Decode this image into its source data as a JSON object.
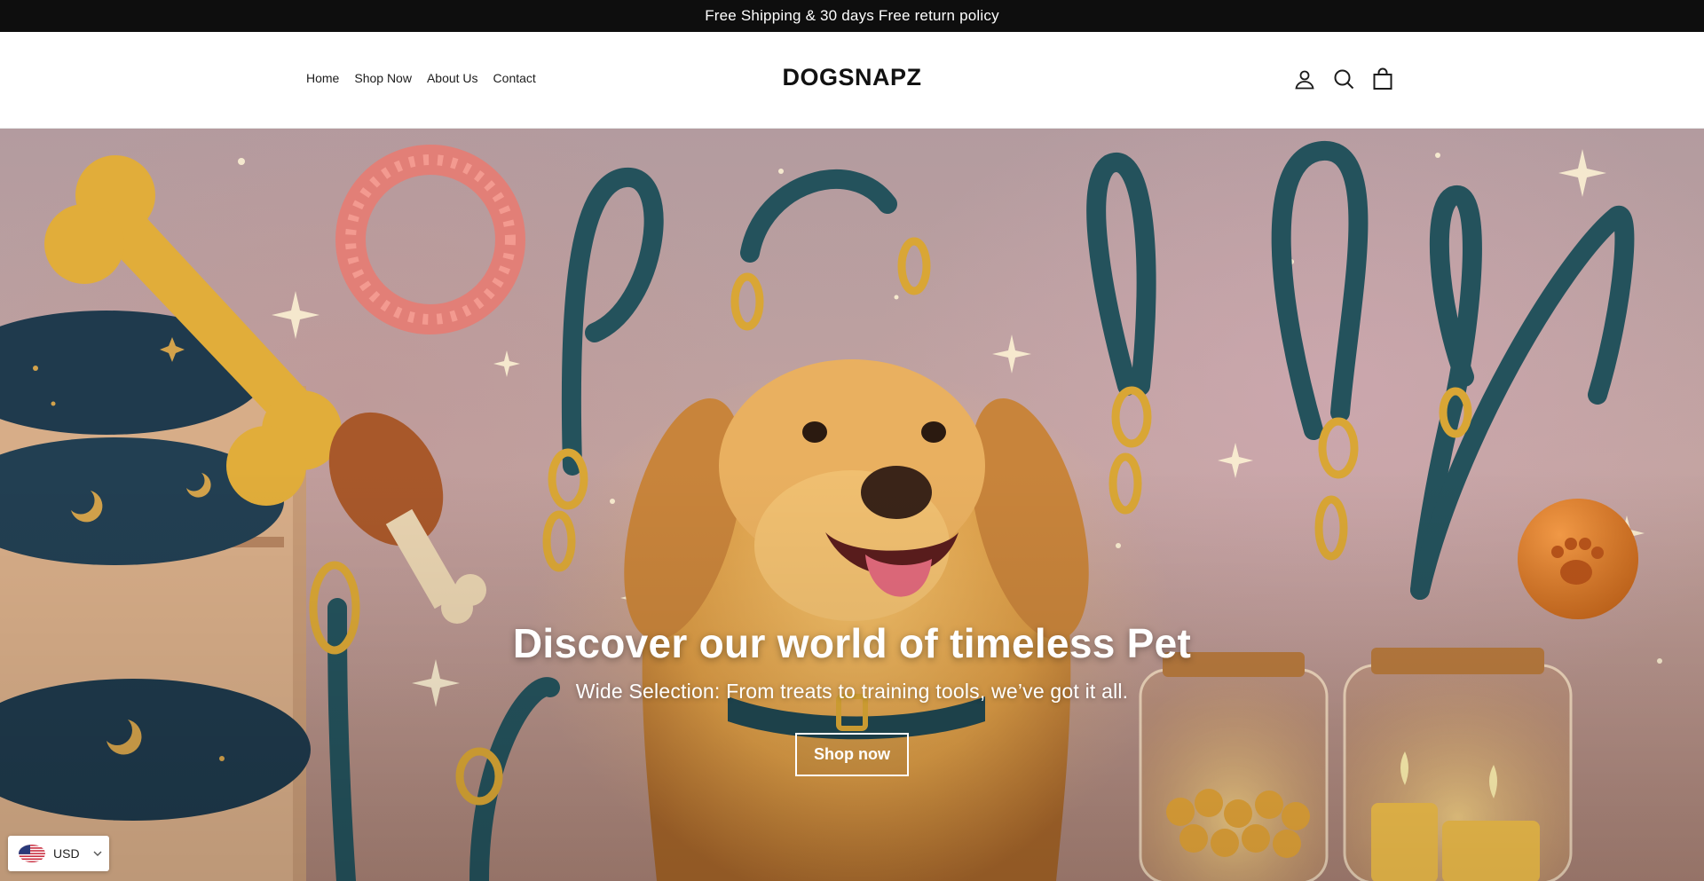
{
  "announcement": {
    "text": "Free Shipping & 30 days Free return policy"
  },
  "header": {
    "logo": "DOGSNAPZ",
    "nav": [
      {
        "label": "Home"
      },
      {
        "label": "Shop Now"
      },
      {
        "label": "About Us"
      },
      {
        "label": "Contact"
      }
    ],
    "icons": [
      "account-icon",
      "search-icon",
      "cart-icon"
    ]
  },
  "hero": {
    "title": "Discover our world of timeless Pet",
    "subtitle": "Wide Selection: From treats to training tools, we’ve got it all.",
    "cta_label": "Shop now"
  },
  "currency": {
    "code": "USD",
    "flag_icon": "us-flag-icon"
  },
  "colors": {
    "announcement_bg": "#0e0e0e",
    "leash": "#24525c",
    "gold": "#d9a635"
  }
}
